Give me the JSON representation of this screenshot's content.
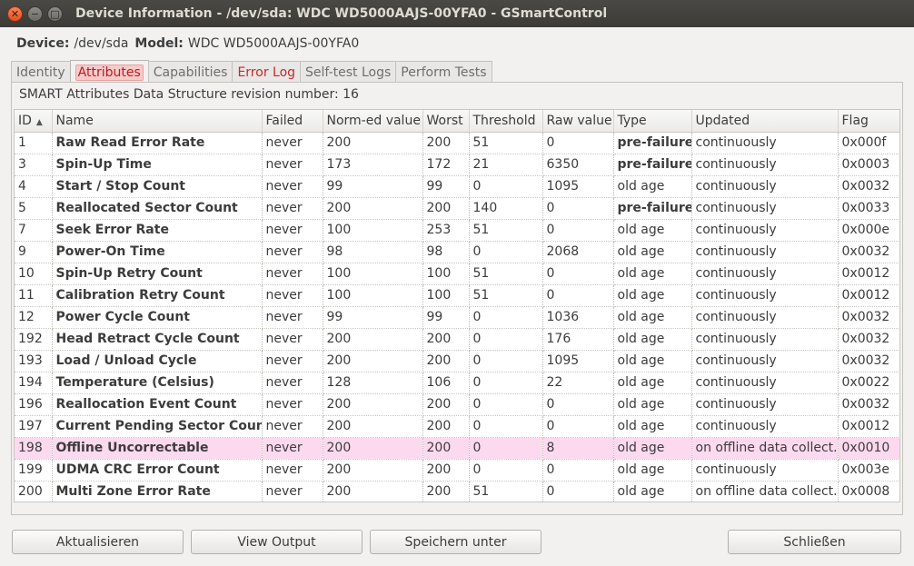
{
  "window": {
    "title": "Device Information - /dev/sda: WDC WD5000AAJS-00YFA0 - GSmartControl",
    "close_glyph": "✕",
    "minimize_glyph": "−",
    "maximize_glyph": "□"
  },
  "device": {
    "device_label": "Device:",
    "device_value": "/dev/sda",
    "model_label": "Model:",
    "model_value": "WDC WD5000AAJS-00YFA0"
  },
  "tabs": [
    {
      "label": "Identity"
    },
    {
      "label": "Attributes"
    },
    {
      "label": "Capabilities"
    },
    {
      "label": "Error Log"
    },
    {
      "label": "Self-test Logs"
    },
    {
      "label": "Perform Tests"
    }
  ],
  "revision_text": "SMART Attributes Data Structure revision number: 16",
  "table": {
    "sort_glyph": "▲",
    "columns": [
      "ID",
      "Name",
      "Failed",
      "Norm-ed value",
      "Worst",
      "Threshold",
      "Raw value",
      "Type",
      "Updated",
      "Flag"
    ],
    "rows": [
      {
        "id": "1",
        "name": "Raw Read Error Rate",
        "failed": "never",
        "norm": "200",
        "worst": "200",
        "threshold": "51",
        "raw": "0",
        "type": "pre-failure",
        "updated": "continuously",
        "flag": "0x000f"
      },
      {
        "id": "3",
        "name": "Spin-Up Time",
        "failed": "never",
        "norm": "173",
        "worst": "172",
        "threshold": "21",
        "raw": "6350",
        "type": "pre-failure",
        "updated": "continuously",
        "flag": "0x0003"
      },
      {
        "id": "4",
        "name": "Start / Stop Count",
        "failed": "never",
        "norm": "99",
        "worst": "99",
        "threshold": "0",
        "raw": "1095",
        "type": "old age",
        "updated": "continuously",
        "flag": "0x0032"
      },
      {
        "id": "5",
        "name": "Reallocated Sector Count",
        "failed": "never",
        "norm": "200",
        "worst": "200",
        "threshold": "140",
        "raw": "0",
        "type": "pre-failure",
        "updated": "continuously",
        "flag": "0x0033"
      },
      {
        "id": "7",
        "name": "Seek Error Rate",
        "failed": "never",
        "norm": "100",
        "worst": "253",
        "threshold": "51",
        "raw": "0",
        "type": "old age",
        "updated": "continuously",
        "flag": "0x000e"
      },
      {
        "id": "9",
        "name": "Power-On Time",
        "failed": "never",
        "norm": "98",
        "worst": "98",
        "threshold": "0",
        "raw": "2068",
        "type": "old age",
        "updated": "continuously",
        "flag": "0x0032"
      },
      {
        "id": "10",
        "name": "Spin-Up Retry Count",
        "failed": "never",
        "norm": "100",
        "worst": "100",
        "threshold": "51",
        "raw": "0",
        "type": "old age",
        "updated": "continuously",
        "flag": "0x0012"
      },
      {
        "id": "11",
        "name": "Calibration Retry Count",
        "failed": "never",
        "norm": "100",
        "worst": "100",
        "threshold": "51",
        "raw": "0",
        "type": "old age",
        "updated": "continuously",
        "flag": "0x0012"
      },
      {
        "id": "12",
        "name": "Power Cycle Count",
        "failed": "never",
        "norm": "99",
        "worst": "99",
        "threshold": "0",
        "raw": "1036",
        "type": "old age",
        "updated": "continuously",
        "flag": "0x0032"
      },
      {
        "id": "192",
        "name": "Head Retract Cycle Count",
        "failed": "never",
        "norm": "200",
        "worst": "200",
        "threshold": "0",
        "raw": "176",
        "type": "old age",
        "updated": "continuously",
        "flag": "0x0032"
      },
      {
        "id": "193",
        "name": "Load / Unload Cycle",
        "failed": "never",
        "norm": "200",
        "worst": "200",
        "threshold": "0",
        "raw": "1095",
        "type": "old age",
        "updated": "continuously",
        "flag": "0x0032"
      },
      {
        "id": "194",
        "name": "Temperature (Celsius)",
        "failed": "never",
        "norm": "128",
        "worst": "106",
        "threshold": "0",
        "raw": "22",
        "type": "old age",
        "updated": "continuously",
        "flag": "0x0022"
      },
      {
        "id": "196",
        "name": "Reallocation Event Count",
        "failed": "never",
        "norm": "200",
        "worst": "200",
        "threshold": "0",
        "raw": "0",
        "type": "old age",
        "updated": "continuously",
        "flag": "0x0032"
      },
      {
        "id": "197",
        "name": "Current Pending Sector Count",
        "failed": "never",
        "norm": "200",
        "worst": "200",
        "threshold": "0",
        "raw": "0",
        "type": "old age",
        "updated": "continuously",
        "flag": "0x0012"
      },
      {
        "id": "198",
        "name": "Offline Uncorrectable",
        "failed": "never",
        "norm": "200",
        "worst": "200",
        "threshold": "0",
        "raw": "8",
        "type": "old age",
        "updated": "on offline data collect.",
        "flag": "0x0010",
        "highlight": true
      },
      {
        "id": "199",
        "name": "UDMA CRC Error Count",
        "failed": "never",
        "norm": "200",
        "worst": "200",
        "threshold": "0",
        "raw": "0",
        "type": "old age",
        "updated": "continuously",
        "flag": "0x003e"
      },
      {
        "id": "200",
        "name": "Multi Zone Error Rate",
        "failed": "never",
        "norm": "200",
        "worst": "200",
        "threshold": "51",
        "raw": "0",
        "type": "old age",
        "updated": "on offline data collect.",
        "flag": "0x0008"
      }
    ]
  },
  "buttons": {
    "refresh": "Aktualisieren",
    "view_output": "View Output",
    "save_as": "Speichern unter",
    "close": "Schließen"
  },
  "colors": {
    "highlight_row": "#fcd9ef",
    "error_tab": "#c62a2a",
    "titlebar": "#3c3b37"
  }
}
